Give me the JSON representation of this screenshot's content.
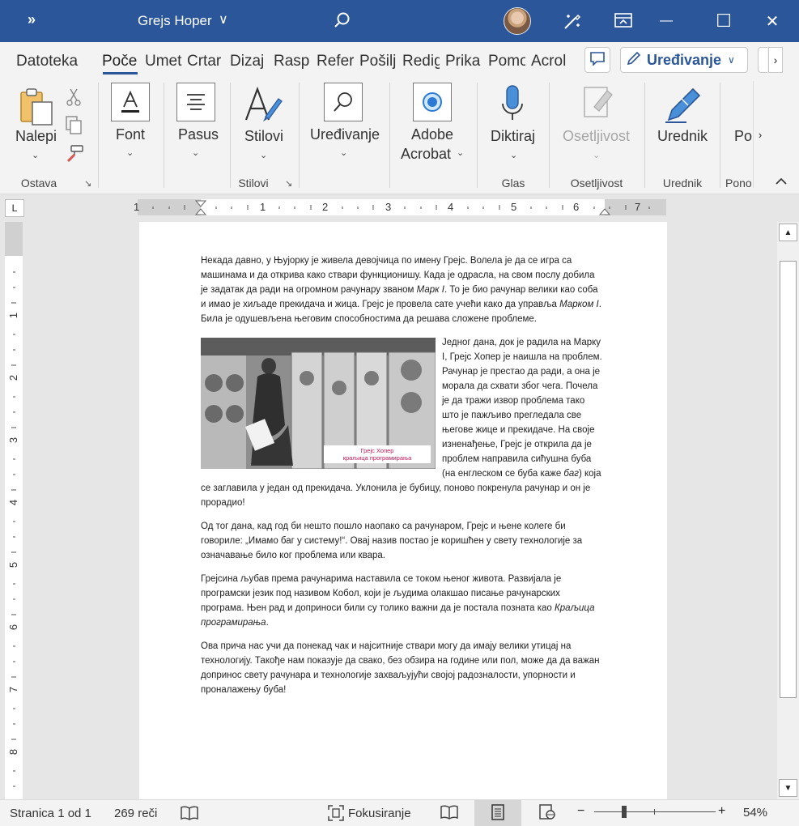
{
  "titlebar": {
    "expand": "»",
    "doc_title": "Grejs Hoper",
    "caret": "∨",
    "minimize": "—",
    "restore": "☐",
    "close": "✕"
  },
  "tabs": [
    "Datoteka",
    "Poče",
    "Umet",
    "Crtar",
    "Dizaj",
    "Rasp",
    "Refer",
    "Pošilj",
    "Redig",
    "Prika",
    "Pomo",
    "Acrol"
  ],
  "edit_mode": {
    "label": "Uređivanje",
    "caret": "∨"
  },
  "ribbon": {
    "paste": "Nalepi",
    "clipboard_group": "Ostava",
    "font": "Font",
    "paragraph": "Pasus",
    "styles": "Stilovi",
    "styles_group": "Stilovi",
    "editing": "Uređivanje",
    "adobe_line1": "Adobe",
    "adobe_line2": "Acrobat",
    "dictate": "Diktiraj",
    "voice_group": "Glas",
    "sensitivity": "Osetljivost",
    "sensitivity_group": "Osetljivost",
    "editor": "Urednik",
    "editor_group": "Urednik",
    "more_label": "Por",
    "more_group": "Pono",
    "caret": "⌄",
    "launcher": "↘"
  },
  "ruler": {
    "h_numbers": [
      "1",
      "1",
      "2",
      "3",
      "4",
      "5",
      "6",
      "7"
    ],
    "v_numbers": [
      "1",
      "2",
      "3",
      "4",
      "5",
      "6",
      "7",
      "8"
    ],
    "corner": "L"
  },
  "document": {
    "p1_a": "Некада давно, у Њујорку је живела девојчица по имену Грејс. Волела је да се игра са машинама и да открива како ствари функционишу. Када је одрасла, на свом послу добила је задатак да ради на огромном рачунару званом ",
    "p1_em1": "Марк I",
    "p1_b": ". То је био рачунар велики као соба и имао је хиљаде прекидача и жица. Грејс је провела сате учећи како да управља ",
    "p1_em2": "Марком I",
    "p1_c": ". Била је одушевљена његовим способностима да решава сложене проблеме.",
    "caption_line1": "Грејс Хопер",
    "caption_line2": "краљица програмирања",
    "p2_a": "Једног дана, док је радила на Марку I, Грејс Хопер је наишла на проблем. Рачунар је престао да ради, а она је морала да схвати због чега. Почела је да тражи извор проблема тако што је пажљиво прегледала све његове жице и прекидаче. На своје изненађење, Грејс је открила да је проблем направила сићушна буба (на енглеском се буба каже ",
    "p2_em": "баг",
    "p2_b": ") која се заглавила у један од прекидача. Уклонила је бубицу, поново покренула рачунар и он је прорадио!",
    "p3": "Од тог дана, кад год би нешто пошло наопако са рачунаром, Грејс и њене колеге би говориле: „Имамо баг у систему!“. Овај назив постао је коришћен у свету технологије за означавање било ког проблема или квара.",
    "p4_a": "Грејсина љубав према рачунарима наставила се током њеног живота. Развијала је програмски језик под називом Кобол, који је људима олакшао писање рачунарских програма. Њен рад и доприноси били су толико важни да је постала позната као ",
    "p4_em": "Краљица програмирања",
    "p4_b": ".",
    "p5": "Ова прича нас учи да понекад чак и најситније ствари могу да имају велики утицај на технологију. Такође нам показује да свако, без обзира на године или пол, може да да важан допринос свету рачунара и технологије захваљујући својој радозналости, упорности и проналажењу буба!"
  },
  "statusbar": {
    "page": "Stranica 1 od 1",
    "words": "269 reči",
    "focus": "Fokusiranje",
    "zoom_minus": "−",
    "zoom_plus": "+",
    "zoom": "54%",
    "zoom_level": 0.54
  },
  "colors": {
    "titlebar": "#2b579a",
    "accent": "#2b579a",
    "caption": "#c2185b"
  }
}
